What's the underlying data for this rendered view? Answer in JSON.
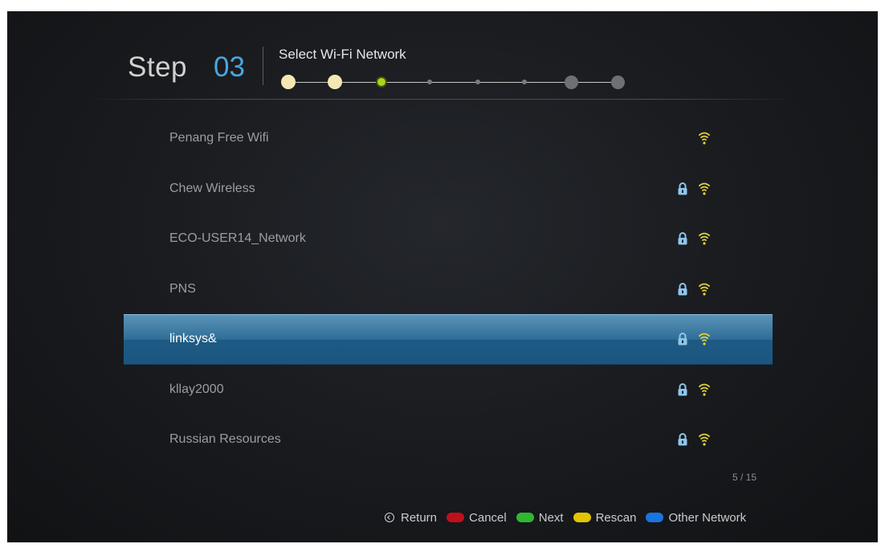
{
  "header": {
    "step_word": "Step",
    "step_number": "03",
    "title": "Select Wi-Fi Network",
    "progress_steps_total": 8,
    "progress_current_step": 3
  },
  "networks": [
    {
      "name": "Penang Free Wifi",
      "secured": false,
      "selected": false
    },
    {
      "name": "Chew Wireless",
      "secured": true,
      "selected": false
    },
    {
      "name": "ECO-USER14_Network",
      "secured": true,
      "selected": false
    },
    {
      "name": "PNS",
      "secured": true,
      "selected": false
    },
    {
      "name": "linksys&",
      "secured": true,
      "selected": true
    },
    {
      "name": "kllay2000",
      "secured": true,
      "selected": false
    },
    {
      "name": "Russian Resources",
      "secured": true,
      "selected": false
    }
  ],
  "pager": "5 / 15",
  "footer": {
    "return_label": "Return",
    "cancel_label": "Cancel",
    "next_label": "Next",
    "rescan_label": "Rescan",
    "other_label": "Other Network"
  },
  "colors": {
    "accent": "#4aa6e0",
    "cancel": "#c0101a",
    "next": "#2fb82f",
    "rescan": "#e2c400",
    "other": "#1a74e0",
    "wifi_icon": "#e3d23a",
    "lock_icon": "#8ec7ee",
    "progress_done": "#f3e7b4",
    "progress_current": "#a8d61c"
  }
}
